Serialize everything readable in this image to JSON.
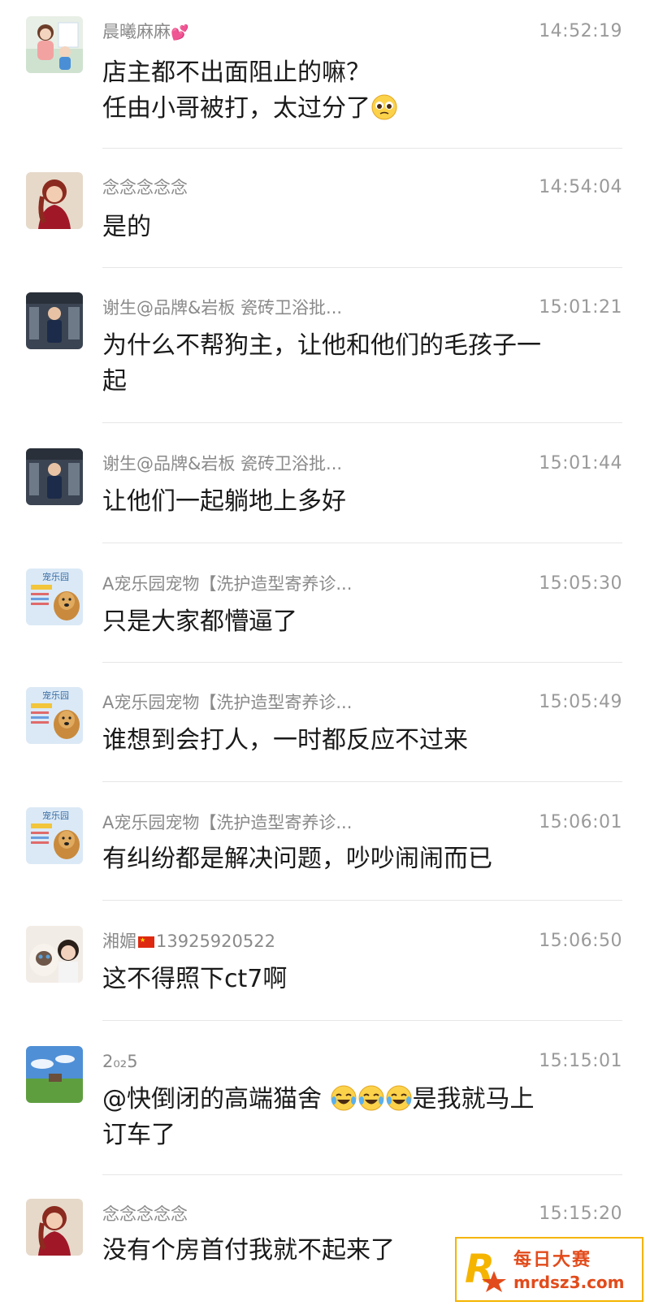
{
  "messages": [
    {
      "sender": "晨曦麻麻",
      "sender_emoji": "two-hearts",
      "time": "14:52:19",
      "lines": [
        "店主都不出面阻止的嘛？",
        "任由小哥被打，太过分了"
      ],
      "trailing_emoji": "pleading-face"
    },
    {
      "sender": "念念念念念",
      "time": "14:54:04",
      "lines": [
        "是的"
      ]
    },
    {
      "sender": "谢生@品牌&岩板 瓷砖卫浴批...",
      "time": "15:01:21",
      "lines": [
        "为什么不帮狗主，让他和他们的毛孩子一",
        "起"
      ]
    },
    {
      "sender": "谢生@品牌&岩板 瓷砖卫浴批...",
      "time": "15:01:44",
      "lines": [
        "让他们一起躺地上多好"
      ]
    },
    {
      "sender": "A宠乐园宠物【洗护造型寄养诊...",
      "time": "15:05:30",
      "lines": [
        "只是大家都懵逼了"
      ]
    },
    {
      "sender": "A宠乐园宠物【洗护造型寄养诊...",
      "time": "15:05:49",
      "lines": [
        "谁想到会打人，一时都反应不过来"
      ]
    },
    {
      "sender": "A宠乐园宠物【洗护造型寄养诊...",
      "time": "15:06:01",
      "lines": [
        "有纠纷都是解决问题，吵吵闹闹而已"
      ]
    },
    {
      "sender": "湘媚",
      "sender_suffix": "13925920522",
      "time": "15:06:50",
      "lines": [
        "这不得照下ct7啊"
      ]
    },
    {
      "sender": "2₀₂5",
      "time": "15:15:01",
      "line1_prefix": "@快倒闭的高端猫舍",
      "line1_suffix": "是我就马上",
      "line2": "订车了"
    },
    {
      "sender": "念念念念念",
      "time": "15:15:20",
      "lines": [
        "没有个房首付我就不起来了"
      ]
    }
  ],
  "avatar_labels": {
    "pet_shop": "宠乐园"
  },
  "watermark": {
    "title": "每日大赛",
    "url": "mrdsz3.com",
    "logo_letter": "R"
  },
  "colors": {
    "text": "#1a1a1a",
    "meta": "#8a8a8a",
    "divider": "#e6e6e6",
    "watermark": "#e24b1b"
  }
}
